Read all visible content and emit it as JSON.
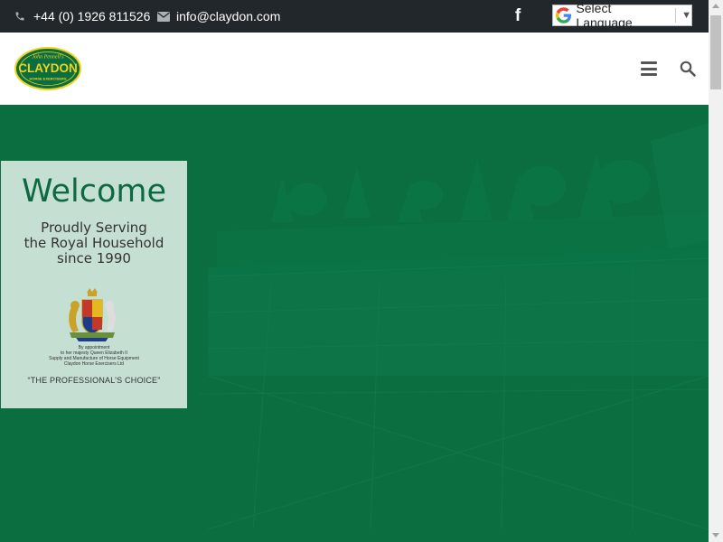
{
  "topbar": {
    "phone": "+44 (0) 1926 811526",
    "email": "info@claydon.com",
    "social_icon": "facebook-icon",
    "translate_label": "Select Language",
    "translate_arrow": "▼"
  },
  "header": {
    "logo_top_text": "John Pennell's",
    "logo_main_text": "CLAYDON",
    "logo_bottom_text": "HORSE EXERCISERS",
    "menu_icon": "hamburger-menu-icon",
    "search_icon": "search-icon"
  },
  "hero": {
    "title": "Welcome",
    "subtitle_lines": [
      "Proudly Serving",
      "the Royal Household",
      "since 1990"
    ],
    "warrant_lines": [
      "By appointment",
      "to her majesty Queen Elizabeth II",
      "Supply and Manufacture of Horse Equipment",
      "Claydon Horse Exercisers Ltd"
    ],
    "tagline": "“THE PROFESSIONAL’S CHOICE”"
  },
  "colors": {
    "topbar_bg": "#22272b",
    "brand_green": "#0a6e41",
    "logo_yellow": "#f2d21b",
    "card_bg": "#c5dfd2"
  }
}
